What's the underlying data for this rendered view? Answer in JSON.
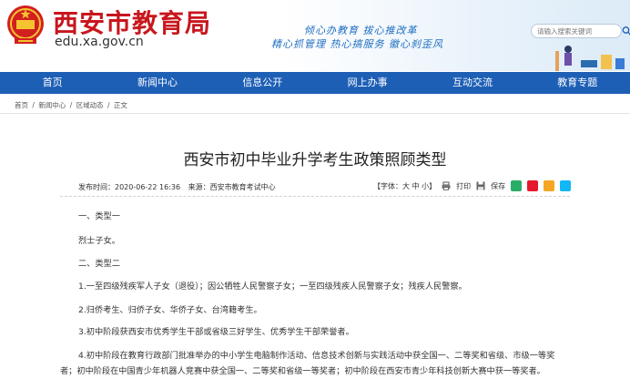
{
  "header": {
    "title": "西安市教育局",
    "url": "edu.xa.gov.cn",
    "slogan_line1": "倾心办教育  拔心推改革",
    "slogan_line2": "精心抓管理  热心搞服务  徽心刹歪风",
    "search_placeholder": "请输入搜索关键词"
  },
  "nav": {
    "items": [
      "首页",
      "新闻中心",
      "信息公开",
      "网上办事",
      "互动交流",
      "教育专题"
    ]
  },
  "breadcrumb": {
    "items": [
      "首页",
      "/",
      "新闻中心",
      "/",
      "区域动态",
      "/",
      "正文"
    ]
  },
  "article": {
    "title": "西安市初中毕业升学考生政策照顾类型",
    "publish_label": "发布时间：2020-06-22 16:36",
    "source_label": "来源：西安市教育考试中心",
    "font_size_label": "【字体：大 中 小】",
    "print_label": "打印",
    "save_label": "保存",
    "paragraphs": [
      "一、类型一",
      "烈士子女。",
      "二、类型二",
      "1.一至四级残疾军人子女（退役）；因公牺牲人民警察子女；一至四级残疾人民警察子女；残疾人民警察。",
      "2.归侨考生、归侨子女、华侨子女、台湾籍考生。",
      "3.初中阶段获西安市优秀学生干部或省级三好学生、优秀学生干部荣誉者。",
      "4.初中阶段在教育行政部门批准举办的中小学生电脑制作活动、信息技术创新与实践活动中获全国一、二等奖和省级、市级一等奖",
      "者；初中阶段在中国青少年机器人竞赛中获全国一、二等奖和省级一等奖者；初中阶段在西安市青少年科技创新大赛中获一等奖者。"
    ]
  },
  "colors": {
    "brand_red": "#c8161d",
    "nav_blue": "#1e5fb6",
    "slogan_blue": "#1f6fc0"
  },
  "icons": [
    "national-emblem-icon",
    "search-icon",
    "print-icon",
    "save-icon",
    "wechat-icon",
    "weibo-icon",
    "qq-icon",
    "qzone-icon"
  ]
}
